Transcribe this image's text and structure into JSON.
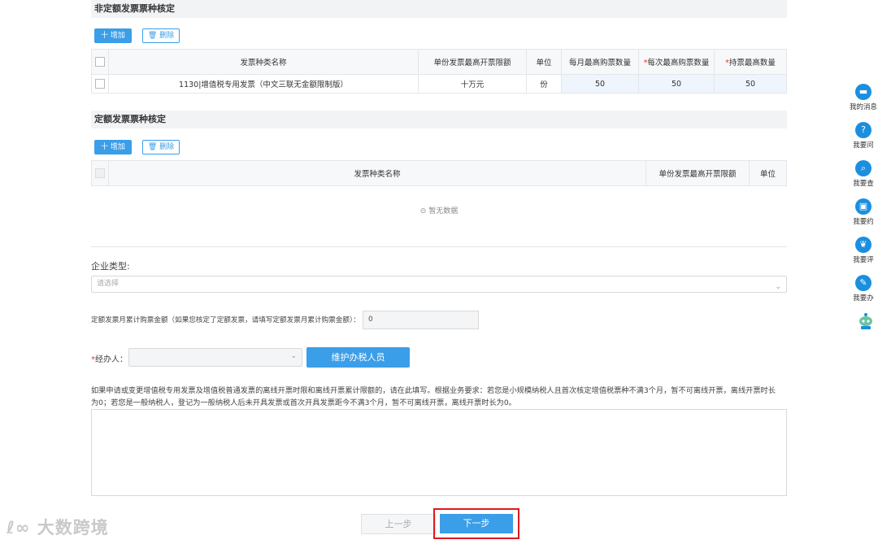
{
  "section1": {
    "title": "非定额发票票种核定",
    "add_label": "十 增加",
    "delete_label": "删除",
    "headers": {
      "name": "发票种类名称",
      "limit": "单份发票最高开票限额",
      "unit": "单位",
      "monthly": "每月最高购票数量",
      "per": "每次最高购票数量",
      "hold": "持票最高数量"
    },
    "row": {
      "name": "1130|增值税专用发票（中文三联无金额限制版）",
      "limit": "十万元",
      "unit": "份",
      "monthly": "50",
      "per": "50",
      "hold": "50"
    }
  },
  "section2": {
    "title": "定额发票票种核定",
    "add_label": "十 增加",
    "delete_label": "删除",
    "headers": {
      "name": "发票种类名称",
      "limit": "单份发票最高开票限额",
      "unit": "单位"
    },
    "empty_text": "暂无数据"
  },
  "enterprise": {
    "label": "企业类型:",
    "placeholder": "请选择"
  },
  "quota": {
    "label": "定额发票月累计购票金额（如果您核定了定额发票，请填写定额发票月累计购票金额）：",
    "value": "0"
  },
  "agent": {
    "required_mark": "*",
    "label": "经办人：",
    "maintain_label": "维护办税人员"
  },
  "hint_text": "如果申请或变更增值税专用发票及增值税普通发票的离线开票时限和离线开票累计限额的，请在此填写。根据业务要求：若您是小规模纳税人且首次核定增值税票种不满3个月，暂不可离线开票，离线开票时长为0；若您是一般纳税人，登记为一般纳税人后未开具发票或首次开具发票距今不满3个月，暂不可离线开票，离线开票时长为0。",
  "nav": {
    "prev_label": "上一步",
    "next_label": "下一步"
  },
  "sidebar": [
    {
      "label": "我的消息",
      "icon": "message-icon"
    },
    {
      "label": "我要问",
      "icon": "question-icon"
    },
    {
      "label": "我要查",
      "icon": "search-icon"
    },
    {
      "label": "我要约",
      "icon": "calendar-icon"
    },
    {
      "label": "我要评",
      "icon": "rating-icon"
    },
    {
      "label": "我要办",
      "icon": "edit-icon"
    }
  ],
  "robot_label": "智能咨询",
  "watermark": "大数跨境",
  "colors": {
    "primary": "#3a9ee8",
    "highlight_border": "#e0191e",
    "sidebar_icon": "#1a8fe0"
  }
}
